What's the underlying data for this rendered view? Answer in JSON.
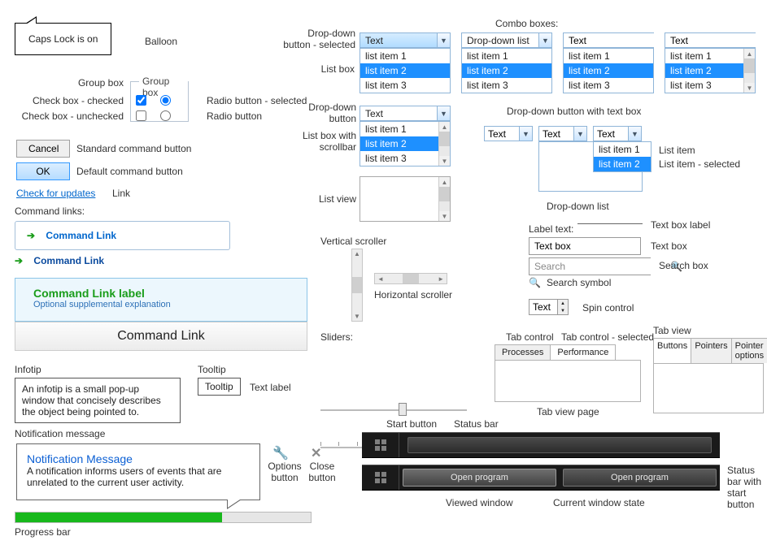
{
  "balloon": {
    "text": "Caps Lock is on",
    "label": "Balloon"
  },
  "groupbox": {
    "label_left": "Group box",
    "legend": "Group box",
    "check_checked_label": "Check box - checked",
    "check_unchecked_label": "Check box - unchecked",
    "radio_selected_label": "Radio button - selected",
    "radio_label": "Radio button"
  },
  "buttons": {
    "cancel": "Cancel",
    "cancel_label": "Standard command button",
    "ok": "OK",
    "ok_label": "Default command button"
  },
  "link": {
    "text": "Check for updates",
    "label": "Link"
  },
  "cmd": {
    "header": "Command links:",
    "link1": "Command Link",
    "link2": "Command Link",
    "big_title": "Command Link label",
    "big_sub": "Optional supplemental explanation",
    "bar": "Command Link"
  },
  "infotip": {
    "label": "Infotip",
    "text": "An infotip is a small pop-up window that concisely describes the object being pointed to."
  },
  "tooltip": {
    "label": "Tooltip",
    "text": "Tooltip",
    "side": "Text label"
  },
  "notif": {
    "label": "Notification message",
    "title": "Notification Message",
    "body": "A notification informs users of events that are unrelated to the current user activity.",
    "options": "Options button",
    "close": "Close button"
  },
  "progress": {
    "label": "Progress bar",
    "value_pct": 70
  },
  "ddsel": {
    "label": "Drop-down button - selected",
    "value": "Text"
  },
  "combo_label": "Combo boxes:",
  "listbox_label": "List box",
  "listbox_items": [
    "list item 1",
    "list item 2",
    "list item 3"
  ],
  "combo1": {
    "value": "Drop-down list",
    "items": [
      "list item 1",
      "list item 2",
      "list item 3"
    ],
    "selected": 1
  },
  "combo2": {
    "value": "Text",
    "items": [
      "list item 1",
      "list item 2",
      "list item 3"
    ],
    "selected": 1
  },
  "combo3": {
    "value": "Text",
    "items": [
      "list item 1",
      "list item 2",
      "list item 3"
    ],
    "selected": 1
  },
  "dd_btn": {
    "label": "Drop-down button",
    "value": "Text"
  },
  "listbox_scroll_label": "List box with scrollbar",
  "listview_label": "List view",
  "vscroll_label": "Vertical scroller",
  "hscroll_label": "Horizontal scroller",
  "sliders_label": "Sliders:",
  "dd_text_label": "Drop-down button with text box",
  "dd_text": {
    "a": "Text",
    "b": "Text",
    "c": "Text",
    "items": [
      "list item 1",
      "list item 2"
    ],
    "selected": 1
  },
  "dd_list_label": "Drop-down list",
  "labeltext": {
    "label": "Label text:",
    "side": "Text box label"
  },
  "textbox": {
    "value": "Text box",
    "side": "Text box"
  },
  "search": {
    "placeholder": "Search",
    "side": "Search box",
    "symlabel": "Search symbol"
  },
  "spin": {
    "value": "Text",
    "side": "Spin control"
  },
  "listitem_labels": {
    "item": "List item",
    "selected": "List item - selected"
  },
  "tabctrl": {
    "tab1": "Processes",
    "tab2": "Performance",
    "label1": "Tab control",
    "label2": "Tab control - selected",
    "pagelabel": "Tab view page"
  },
  "tabview": {
    "label": "Tab view",
    "tabs": [
      "Buttons",
      "Pointers",
      "Pointer options"
    ]
  },
  "status": {
    "start_label": "Start button",
    "bar_label": "Status bar",
    "open": "Open program",
    "viewed": "Viewed window",
    "current": "Current window state",
    "sidebar_label": "Status bar with start button"
  }
}
